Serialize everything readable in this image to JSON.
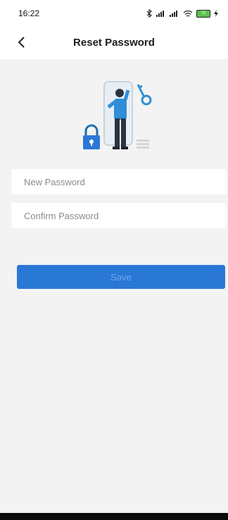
{
  "status_bar": {
    "time": "16:22",
    "battery": "70"
  },
  "header": {
    "title": "Reset Password"
  },
  "form": {
    "new_password_placeholder": "New Password",
    "confirm_password_placeholder": "Confirm Password"
  },
  "save_button": {
    "label": "Save"
  },
  "colors": {
    "accent": "#2a78d6",
    "background": "#f3f3f3"
  },
  "icons": [
    "back-arrow-icon",
    "bluetooth-icon",
    "signal-icon",
    "wifi-icon",
    "battery-icon",
    "reset-password-illustration"
  ]
}
